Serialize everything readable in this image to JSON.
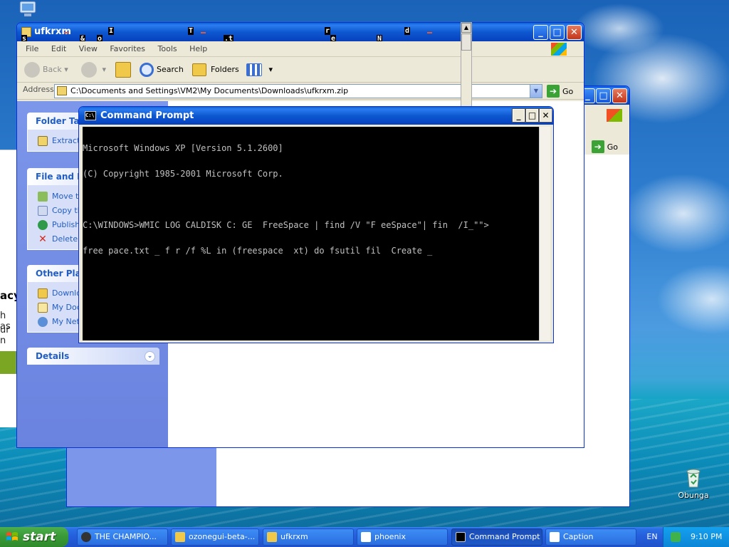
{
  "desktop": {
    "recycle_label": "Obunga"
  },
  "back_window": {
    "go_label": "Go",
    "partial_texts": [
      "acy",
      "h as",
      "ur n"
    ]
  },
  "explorer": {
    "title": "ufkrxm",
    "garbled_title_chars": [
      "s",
      "&",
      "o",
      "I",
      "T",
      ".t",
      "r",
      "e",
      "N",
      "d"
    ],
    "menu": [
      "File",
      "Edit",
      "View",
      "Favorites",
      "Tools",
      "Help"
    ],
    "toolbar": {
      "back": "Back",
      "search": "Search",
      "folders": "Folders"
    },
    "address_label": "Address",
    "address_value": "C:\\Documents and Settings\\VM2\\My Documents\\Downloads\\ufkrxm.zip",
    "go_label": "Go",
    "panels": {
      "folder_tasks": {
        "header": "Folder Tas",
        "items": [
          "Extract"
        ]
      },
      "file_folder": {
        "header": "File and Fo",
        "items": [
          "Move th",
          "Copy th",
          "Publish",
          "Delete"
        ]
      },
      "other_places": {
        "header": "Other Plac",
        "items": [
          "Downlo",
          "My Doc",
          "My Net"
        ]
      },
      "details": {
        "header": "Details"
      }
    }
  },
  "cmd": {
    "title": "Command Prompt",
    "lines": [
      "Microsoft Windows XP [Version 5.1.2600]",
      "(C) Copyright 1985-2001 Microsoft Corp.",
      "",
      "C:\\WINDOWS>WMIC LOG CALDISK C: GE  FreeSpace | find /V \"F eeSpace\"| fin  /I_\"\">",
      "free pace.txt _ f r /f %L in (freespace  xt) do fsutil fil  Create _"
    ]
  },
  "taskbar": {
    "start_label": "start",
    "tasks": [
      {
        "label": "THE CHAMPIO..."
      },
      {
        "label": "ozonegui-beta-..."
      },
      {
        "label": "ufkrxm"
      },
      {
        "label": "phoenix"
      },
      {
        "label": "Command Prompt"
      },
      {
        "label": "Caption"
      }
    ],
    "language": "EN",
    "clock": "9:10 PM"
  },
  "colors": {
    "xp_blue_title": "#0a5fd8",
    "start_green": "#3a9a38",
    "task_pane_blue": "#7c96ea",
    "console_text": "#c0c0c0"
  }
}
